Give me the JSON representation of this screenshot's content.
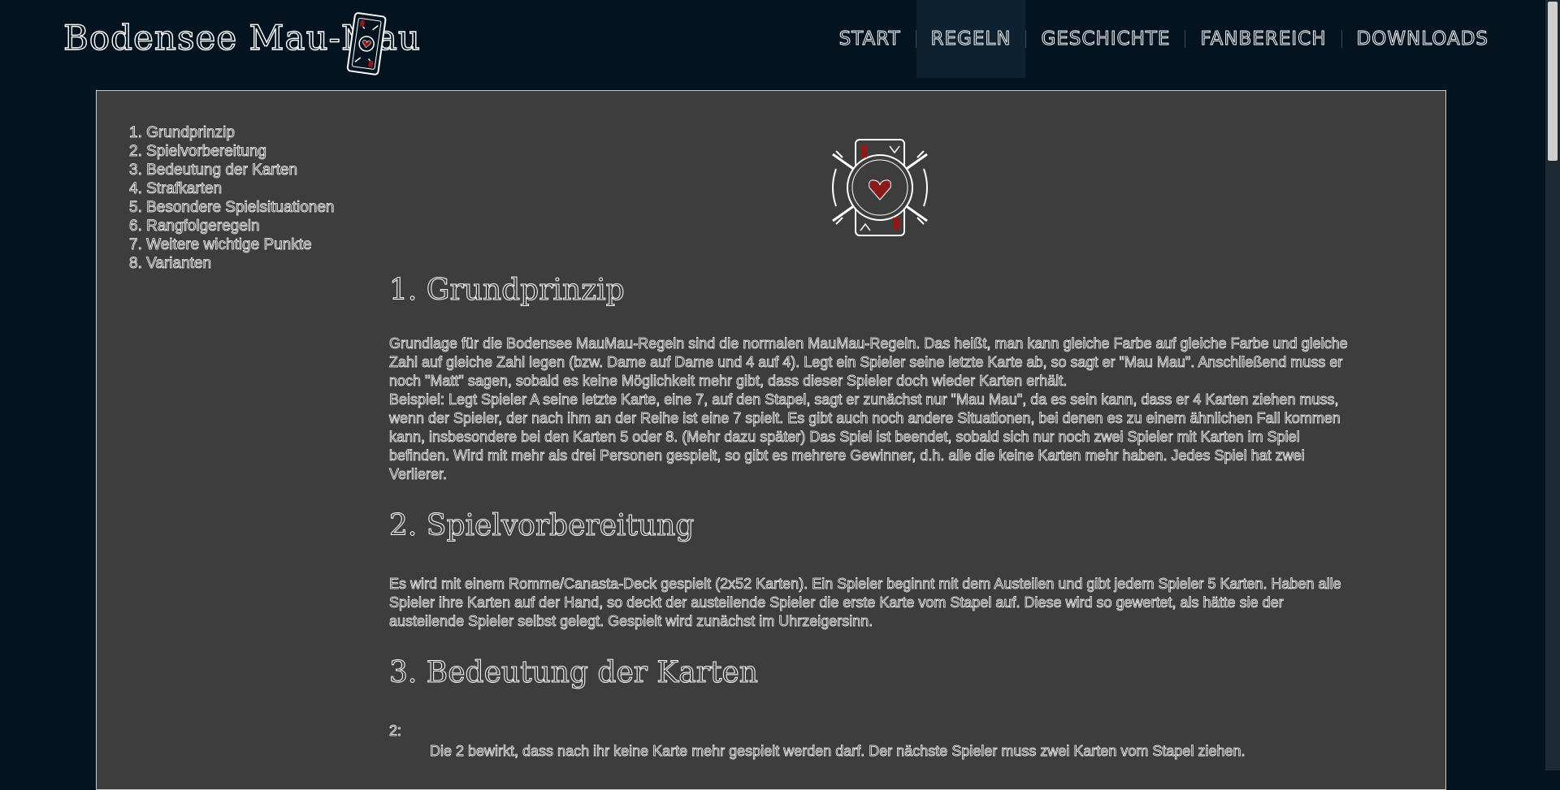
{
  "header": {
    "brand": "Bodensee Mau-Mau",
    "nav": [
      {
        "label": "START"
      },
      {
        "label": "REGELN"
      },
      {
        "label": "GESCHICHTE"
      },
      {
        "label": "FANBEREICH"
      },
      {
        "label": "DOWNLOADS"
      }
    ]
  },
  "toc": [
    "1. Grundprinzip",
    "2. Spielvorbereitung",
    "3. Bedeutung der Karten",
    "4. Strafkarten",
    "5. Besondere Spielsituationen",
    "6. Rangfolgeregeln",
    "7. Weitere wichtige Punkte",
    "8. Varianten"
  ],
  "sections": [
    {
      "title": "1. Grundprinzip",
      "paragraphs": [
        "Grundlage für die Bodensee MauMau-Regeln sind die normalen MauMau-Regeln. Das heißt, man kann gleiche Farbe auf gleiche Farbe und gleiche Zahl auf gleiche Zahl legen (bzw. Dame auf Dame und 4 auf 4). Legt ein Spieler seine letzte Karte ab, so sagt er \"Mau Mau\". Anschließend muss er noch \"Matt\" sagen, sobald es keine Möglichkeit mehr gibt, dass dieser Spieler doch wieder Karten erhält.",
        "Beispiel: Legt Spieler A seine letzte Karte, eine 7, auf den Stapel, sagt er zunächst nur \"Mau Mau\", da es sein kann, dass er 4 Karten ziehen muss, wenn der Spieler, der nach ihm an der Reihe ist eine 7 spielt. Es gibt auch noch andere Situationen, bei denen es zu einem ähnlichen Fall kommen kann, insbesondere bei den Karten 5 oder 8. (Mehr dazu später) Das Spiel ist beendet, sobald sich nur noch zwei Spieler mit Karten im Spiel befinden. Wird mit mehr als drei Personen gespielt, so gibt es mehrere Gewinner, d.h. alle die keine Karten mehr haben. Jedes Spiel hat zwei Verlierer."
      ]
    },
    {
      "title": "2. Spielvorbereitung",
      "paragraphs": [
        "Es wird mit einem Romme/Canasta-Deck gespielt (2x52 Karten). Ein Spieler beginnt mit dem Austeilen und gibt jedem Spieler 5 Karten. Haben alle Spieler ihre Karten auf der Hand, so deckt der austeilende Spieler die erste Karte vom Stapel auf. Diese wird so gewertet, als hätte sie der austeilende Spieler selbst gelegt. Gespielt wird zunächst im Uhrzeigersinn."
      ]
    },
    {
      "title": "3. Bedeutung der Karten",
      "sub_label": "2:",
      "sub_text": "Die 2 bewirkt, dass nach ihr keine Karte mehr gespielt werden darf. Der nächste Spieler muss zwei Karten vom Stapel ziehen."
    }
  ],
  "colors": {
    "background": "#041320",
    "panel": "#3d3d3d",
    "panel_border": "#c9c9c9",
    "active_nav": "#0d2130",
    "heart": "#8b1a1a"
  },
  "icons": {
    "brand_card": "playing-card-heart-icon",
    "logo": "card-cross-heart-logo"
  }
}
